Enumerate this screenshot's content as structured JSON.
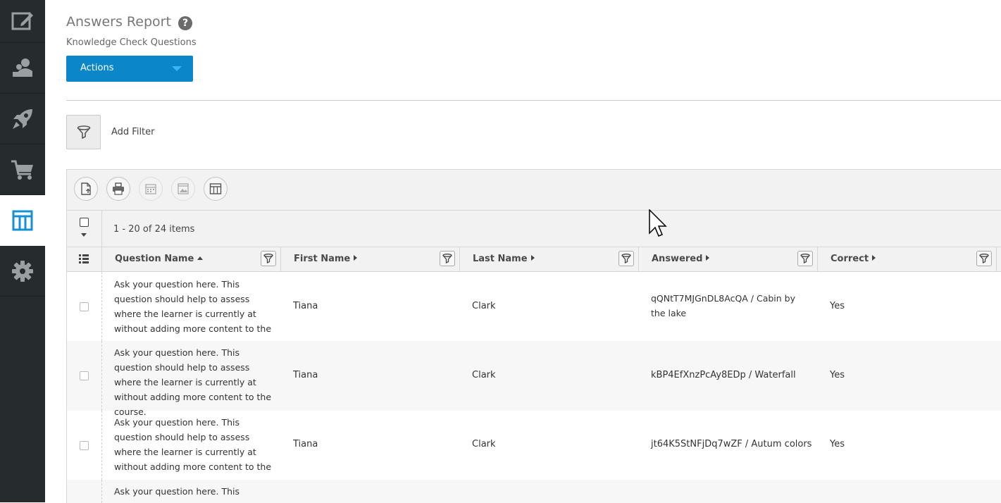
{
  "sidebar": {
    "items": [
      {
        "name": "editor",
        "icon": "edit-window-icon",
        "active": false
      },
      {
        "name": "users",
        "icon": "users-icon",
        "active": false
      },
      {
        "name": "launch",
        "icon": "rocket-icon",
        "active": false
      },
      {
        "name": "store",
        "icon": "shopping-cart-icon",
        "active": false
      },
      {
        "name": "reports",
        "icon": "table-columns-icon",
        "active": true
      },
      {
        "name": "settings",
        "icon": "gear-icon",
        "active": false
      }
    ],
    "accent": "#0a86c9"
  },
  "header": {
    "title": "Answers Report",
    "subtitle": "Knowledge Check Questions",
    "actions_label": "Actions"
  },
  "filter": {
    "add_label": "Add Filter"
  },
  "grid": {
    "items_count": "1 - 20 of 24 items",
    "toolbar": [
      "export-icon",
      "print-icon",
      "schedule-icon",
      "image-icon",
      "columns-icon"
    ],
    "columns": [
      {
        "label": "Question Name",
        "sort": "asc"
      },
      {
        "label": "First Name",
        "sort": "none"
      },
      {
        "label": "Last Name",
        "sort": "none"
      },
      {
        "label": "Answered",
        "sort": "none"
      },
      {
        "label": "Correct",
        "sort": "none"
      }
    ],
    "rows": [
      {
        "question": "Ask your question here. This question should help to assess where the learner is currently at without adding more content to the course.",
        "first": "Tiana",
        "last": "Clark",
        "answered": "qQNtT7MJGnDL8AcQA / Cabin by the lake",
        "correct": "Yes"
      },
      {
        "question": "Ask your question here. This question should help to assess where the learner is currently at without adding more content to the course.",
        "first": "Tiana",
        "last": "Clark",
        "answered": "kBP4EfXnzPcAy8EDp / Waterfall",
        "correct": "Yes"
      },
      {
        "question": "Ask your question here. This question should help to assess where the learner is currently at without adding more content to the course.",
        "first": "Tiana",
        "last": "Clark",
        "answered": "jt64K5StNFjDq7wZF / Autum colors",
        "correct": "Yes"
      },
      {
        "question": "Ask your question here. This",
        "first": "",
        "last": "",
        "answered": "",
        "correct": ""
      }
    ]
  }
}
